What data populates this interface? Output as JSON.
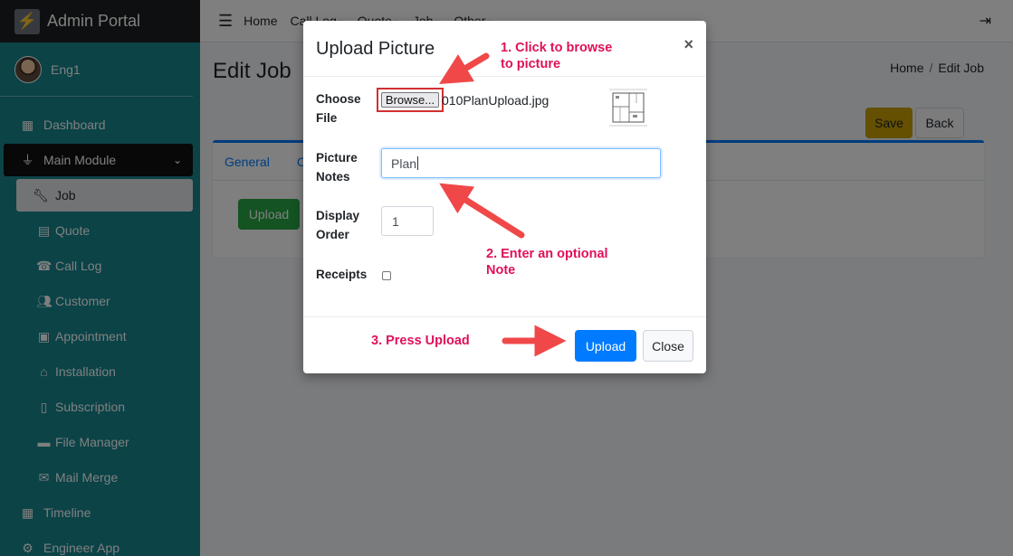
{
  "brand": {
    "title": "Admin Portal"
  },
  "user": {
    "name": "Eng1"
  },
  "sidebar": {
    "items": [
      {
        "label": "Dashboard",
        "icon": "dashboard-icon"
      },
      {
        "label": "Main Module",
        "icon": "plug-icon"
      },
      {
        "label": "Job",
        "icon": "wrench-icon"
      },
      {
        "label": "Quote",
        "icon": "calculator-icon"
      },
      {
        "label": "Call Log",
        "icon": "user-phone-icon"
      },
      {
        "label": "Customer",
        "icon": "users-icon"
      },
      {
        "label": "Appointment",
        "icon": "calendar-check-icon"
      },
      {
        "label": "Installation",
        "icon": "home-icon"
      },
      {
        "label": "Subscription",
        "icon": "file-invoice-icon"
      },
      {
        "label": "File Manager",
        "icon": "folder-icon"
      },
      {
        "label": "Mail Merge",
        "icon": "mail-bulk-icon"
      },
      {
        "label": "Timeline",
        "icon": "calendar-icon"
      },
      {
        "label": "Engineer App",
        "icon": "user-cog-icon"
      }
    ]
  },
  "topnav": {
    "home": "Home",
    "call_log": "Call Log",
    "quote": "Quote",
    "job": "Job",
    "other": "Other"
  },
  "page": {
    "title": "Edit Job",
    "breadcrumb_home": "Home",
    "breadcrumb_current": "Edit Job",
    "save_label": "Save",
    "back_label": "Back",
    "tab_general": "General",
    "tab_second": "C",
    "upload_label": "Upload"
  },
  "modal": {
    "title": "Upload Picture",
    "close_glyph": "×",
    "choose_file_label": "Choose File",
    "browse_label": "Browse...",
    "file_name": "010PlanUpload.jpg",
    "picture_notes_label": "Picture Notes",
    "picture_notes_value": "Plan",
    "display_order_label": "Display Order",
    "display_order_value": "1",
    "receipts_label": "Receipts",
    "upload_label": "Upload",
    "close_label": "Close"
  },
  "annotations": {
    "step1_line1": "1. Click to browse",
    "step1_line2": "to picture",
    "step2_line1": "2. Enter an optional",
    "step2_line2": "Note",
    "step3": "3. Press Upload"
  },
  "colors": {
    "sidebar_bg": "#17878f",
    "primary": "#007bff",
    "success": "#28a745",
    "warning": "#c8a000",
    "annotation": "#e0105a",
    "arrow": "#f04848"
  }
}
